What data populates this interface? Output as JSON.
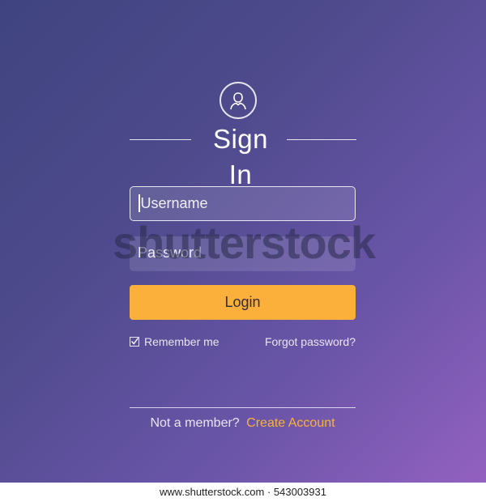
{
  "header": {
    "title": "Sign In",
    "avatar_icon": "user-icon"
  },
  "form": {
    "username_placeholder": "Username",
    "password_placeholder": "Password",
    "login_label": "Login",
    "remember_label": "Remember me",
    "remember_checked": true,
    "forgot_label": "Forgot password?"
  },
  "signup": {
    "prompt": "Not a member?",
    "link": "Create Account"
  },
  "watermark": {
    "text": "shutterstock"
  },
  "footer": {
    "text": "www.shutterstock.com · 543003931"
  },
  "colors": {
    "accent": "#fbb03b",
    "gradient_start": "#3f4480",
    "gradient_end": "#9361c0"
  }
}
